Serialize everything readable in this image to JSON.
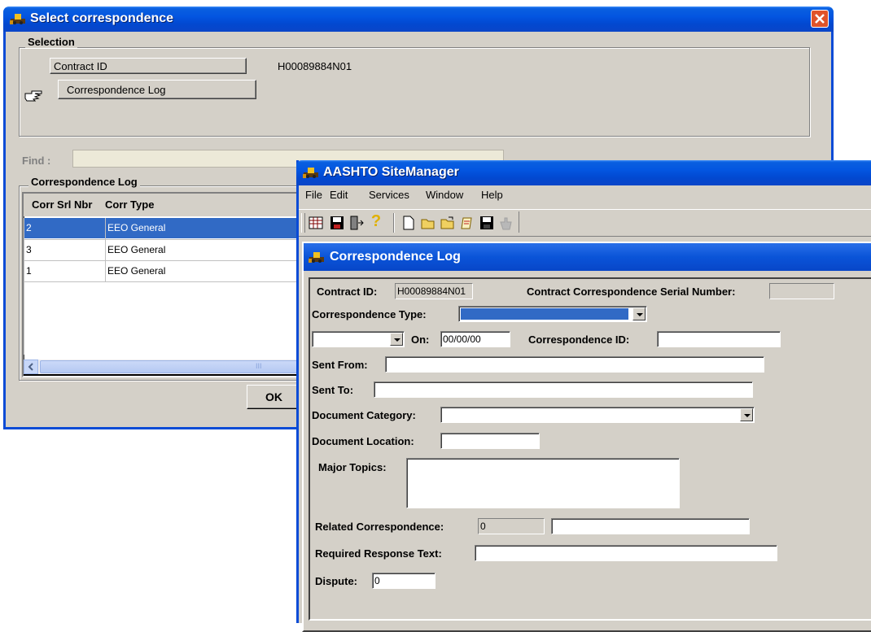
{
  "select_dialog": {
    "title": "Select correspondence",
    "selection_group_title": "Selection",
    "contract_id_label": "Contract ID",
    "contract_id_value": "H00089884N01",
    "correspondence_log_button": "Correspondence Log",
    "find_label": "Find :",
    "find_value": "",
    "log_group_title": "Correspondence Log",
    "table": {
      "headers": [
        "Corr Srl Nbr",
        "Corr Type"
      ],
      "rows": [
        {
          "nbr": "2",
          "type": "EEO General",
          "selected": true
        },
        {
          "nbr": "3",
          "type": "EEO General",
          "selected": false
        },
        {
          "nbr": "1",
          "type": "EEO General",
          "selected": false
        }
      ]
    },
    "ok_label": "OK",
    "scroll_mark": "III"
  },
  "app_window": {
    "title": "AASHTO SiteManager",
    "menu": [
      "File",
      "Edit",
      "Services",
      "Window",
      "Help"
    ],
    "toolbar_icons": [
      "grid-icon",
      "save-disk-icon",
      "exit-door-icon",
      "help-icon",
      "new-doc-icon",
      "open-folder-icon",
      "open-folder-2-icon",
      "notes-icon",
      "floppy-icon",
      "hand-icon"
    ]
  },
  "log_form": {
    "title": "Correspondence Log",
    "contract_id_label": "Contract ID:",
    "contract_id_value": "H00089884N01",
    "serial_label": "Contract Correspondence Serial Number:",
    "serial_value": "",
    "type_label": "Correspondence Type:",
    "type_value": "",
    "direction_value": "",
    "on_label": "On:",
    "on_value": "00/00/00",
    "corr_id_label": "Correspondence ID:",
    "corr_id_value": "",
    "sent_from_label": "Sent From:",
    "sent_from_value": "",
    "sent_to_label": "Sent To:",
    "sent_to_value": "",
    "doc_category_label": "Document Category:",
    "doc_category_value": "",
    "doc_location_label": "Document Location:",
    "doc_location_value": "",
    "major_topics_label": "Major Topics:",
    "major_topics_value": "",
    "related_label": "Related Correspondence:",
    "related_value": "0",
    "related_text": "",
    "required_label": "Required Response Text:",
    "required_value": "",
    "dispute_label": "Dispute:",
    "dispute_value": "0"
  }
}
